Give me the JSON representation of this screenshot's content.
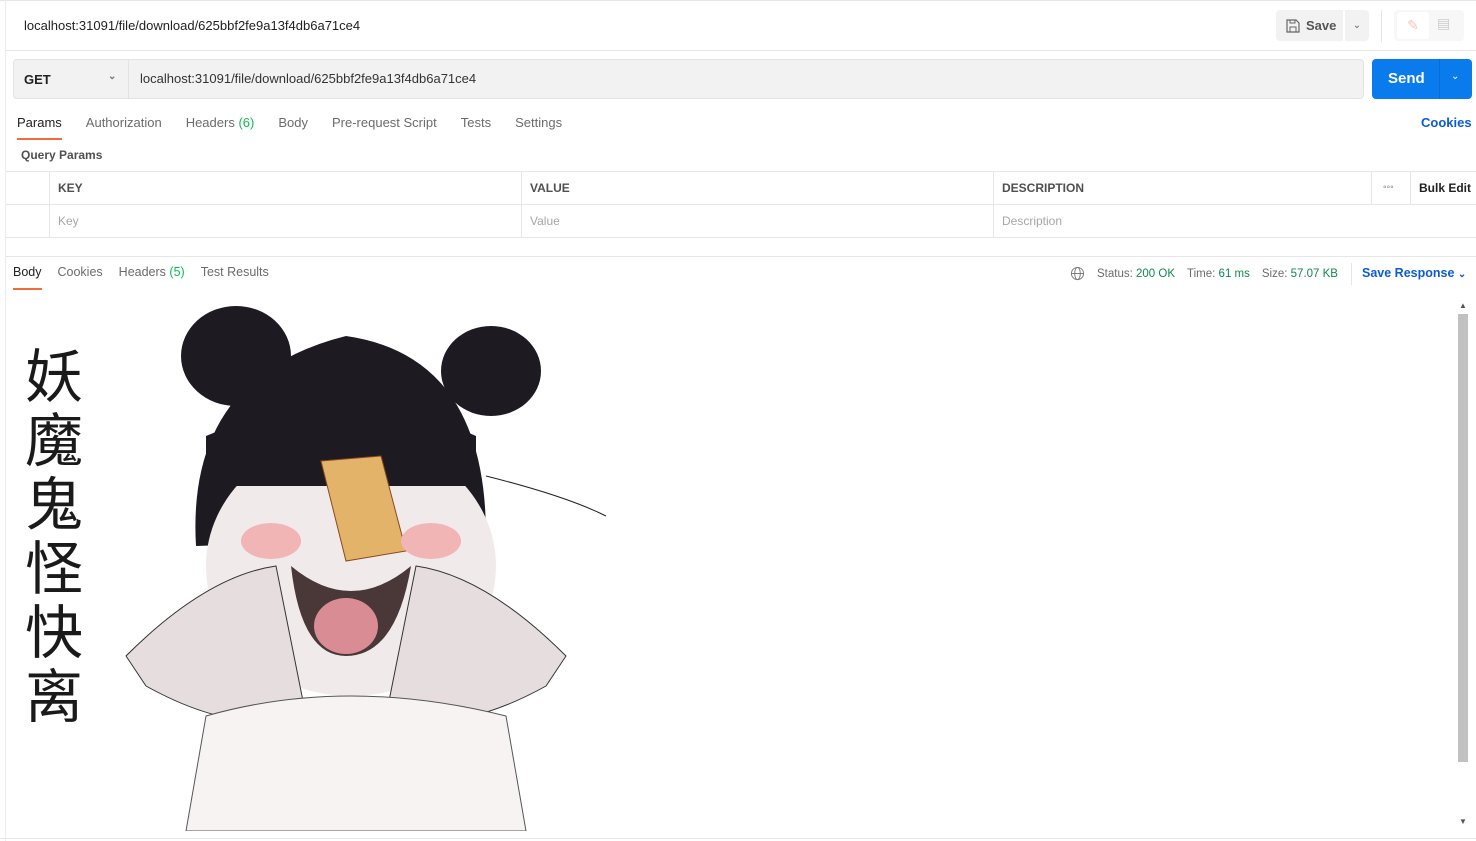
{
  "request": {
    "title": "localhost:31091/file/download/625bbf2fe9a13f4db6a71ce4",
    "save_label": "Save",
    "method": "GET",
    "url": "localhost:31091/file/download/625bbf2fe9a13f4db6a71ce4",
    "send_label": "Send",
    "accent": "#097bed"
  },
  "tabs": [
    {
      "label": "Params",
      "active": true
    },
    {
      "label": "Authorization"
    },
    {
      "label": "Headers",
      "count": "(6)"
    },
    {
      "label": "Body"
    },
    {
      "label": "Pre-request Script"
    },
    {
      "label": "Tests"
    },
    {
      "label": "Settings"
    }
  ],
  "cookies_label": "Cookies",
  "query_params": {
    "title": "Query Params",
    "headers": {
      "key": "KEY",
      "value": "VALUE",
      "description": "DESCRIPTION",
      "bulk_edit": "Bulk Edit"
    },
    "placeholders": {
      "key": "Key",
      "value": "Value",
      "description": "Description"
    }
  },
  "response": {
    "tabs": [
      {
        "label": "Body",
        "active": true
      },
      {
        "label": "Cookies"
      },
      {
        "label": "Headers",
        "count": "(5)"
      },
      {
        "label": "Test Results"
      }
    ],
    "status_label": "Status:",
    "status": "200 OK",
    "time_label": "Time:",
    "time": "61 ms",
    "size_label": "Size:",
    "size": "57.07 KB",
    "save_response": "Save Response",
    "image_lettering": "妖魔鬼怪快离"
  }
}
